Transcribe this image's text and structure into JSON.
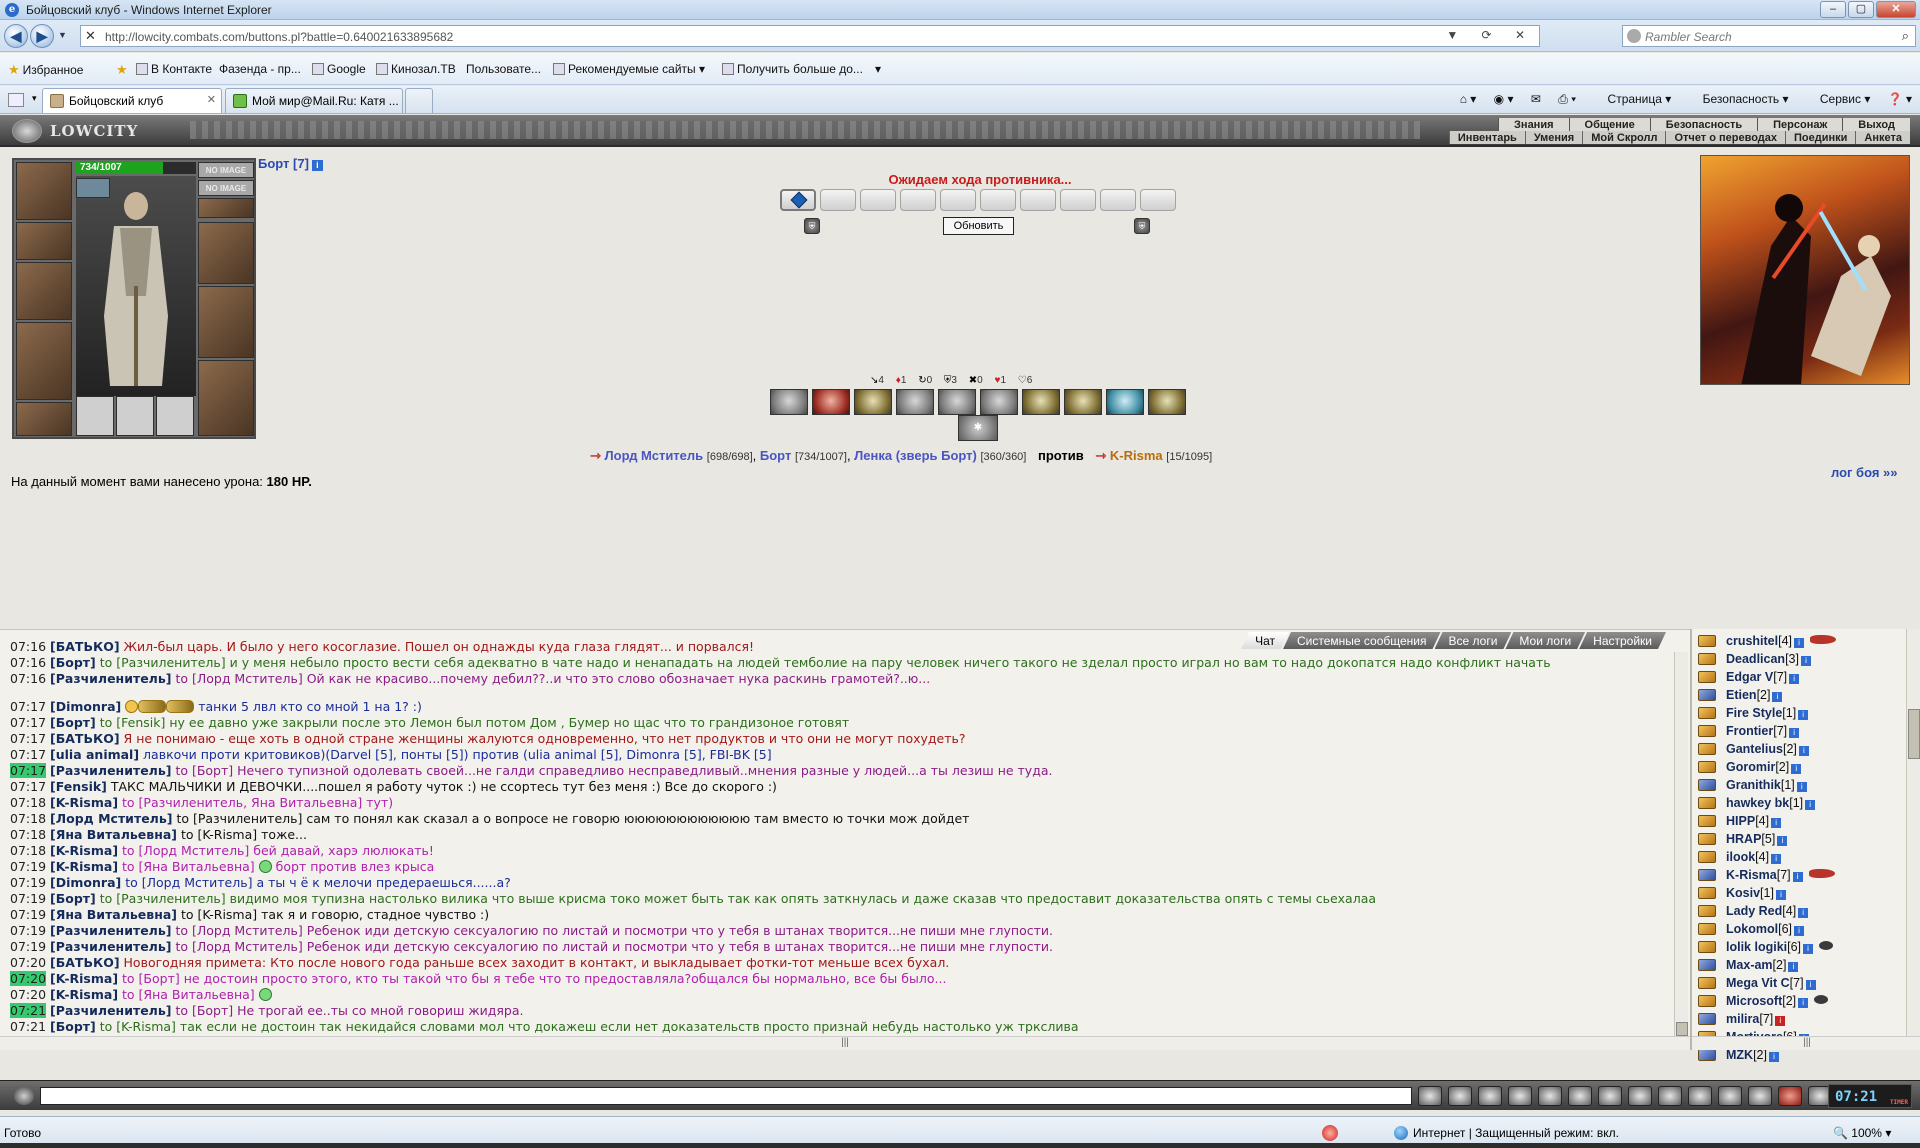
{
  "window": {
    "title": "Бойцовский клуб - Windows Internet Explorer"
  },
  "browser": {
    "url": "http://lowcity.combats.com/buttons.pl?battle=0.640021633895682",
    "search_placeholder": "Rambler Search",
    "favorites_label": "Избранное",
    "favorites": [
      "В Контакте",
      "Фазенда - пр...",
      "Google",
      "Кинозал.ТВ",
      "Пользовате...",
      "Рекомендуемые сайты",
      "Получить больше до..."
    ],
    "tabs": [
      {
        "label": "Бойцовский клуб",
        "active": true
      },
      {
        "label": "Мой мир@Mail.Ru: Катя ...",
        "active": false
      }
    ],
    "tools": {
      "page": "Страница",
      "safety": "Безопасность",
      "service": "Сервис"
    },
    "status_ready": "Готово",
    "status_zone": "Интернет | Защищенный режим: вкл.",
    "zoom": "100%"
  },
  "game": {
    "logo": "LOWCITY",
    "menu_top": [
      "Знания",
      "Общение",
      "Безопасность",
      "Персонаж",
      "Выход"
    ],
    "menu_bottom": [
      "Инвентарь",
      "Умения",
      "Мой Скролл",
      "Отчет о переводах",
      "Поединки",
      "Анкета"
    ],
    "character": {
      "name": "Борт [7]",
      "hp_text": "734/1007",
      "hp_fraction": 0.729,
      "noimage": [
        "NO IMAGE",
        "NO IMAGE"
      ]
    },
    "battle": {
      "waiting": "Ожидаем хода противника...",
      "refresh_label": "Обновить",
      "counters": [
        "4",
        "1",
        "0",
        "3",
        "0",
        "1",
        "6"
      ],
      "team1": [
        {
          "name": "Лорд Мститель",
          "hp": "[698/698]"
        },
        {
          "name": "Борт",
          "hp": "[734/1007]"
        },
        {
          "name": "Ленка (зверь Борт)",
          "hp": "[360/360]"
        }
      ],
      "vs": "против",
      "team2": [
        {
          "name": "K-Risma",
          "hp": "[15/1095]"
        }
      ],
      "damage_label": "На данный момент вами нанесено урона:",
      "damage_value": "180 HP.",
      "log_link": "лог боя »»"
    }
  },
  "chat": {
    "tabs": [
      "Чат",
      "Системные сообщения",
      "Все логи",
      "Мои логи",
      "Настройки"
    ],
    "messages": [
      {
        "time": "07:16",
        "name": "[БАТЬКО]",
        "to": "",
        "text": "Жил-был царь. И было у него косоглазие. Пошел он однажды куда глаза глядят... и порвался!",
        "color": "red"
      },
      {
        "time": "07:16",
        "name": "[Борт]",
        "to": "to [Разчиленитель]",
        "text": "и у меня небыло просто вести себя адекватно в чате надо и ненападать на людей темболие на пару человек ничего такого не зделал просто играл но вам то надо докопатся надо конфликт начать",
        "color": "green"
      },
      {
        "time": "07:16",
        "name": "[Разчиленитель]",
        "to": "to [Лорд Мститель]",
        "text": "Ой как не красиво...почему дебил??..и что это слово обозначает нука раскинь грамотей?..ю...",
        "color": "purple"
      },
      {
        "time": "07:17",
        "name": "[Dimonra]",
        "to": "",
        "text": "танки 5 лвл кто со мной 1 на 1? :)",
        "color": "blue"
      },
      {
        "time": "07:17",
        "name": "[Борт]",
        "to": "to [Fensik]",
        "text": "ну ее давно уже закрыли после это Лемон был потом Дом , Бумер но щас что то грандизоное готовят",
        "color": "green"
      },
      {
        "time": "07:17",
        "name": "[БАТЬКО]",
        "to": "",
        "text": "Я не понимаю - еще хоть в одной стране женщины жалуются одновременно, что нет продуктов и что они не могут похудеть?",
        "color": "red"
      },
      {
        "time": "07:17",
        "name": "[ulia animal]",
        "to": "",
        "text": "лавкочи проти критовиков)(Darvel [5], понты [5]) против (ulia animal [5], Dimonra [5], FBI-BK [5]",
        "color": "blue"
      },
      {
        "time": "07:17",
        "name": "[Разчиленитель]",
        "to": "to [Борт]",
        "text": "Нечего тупизной одолевать своей...не галди справедливо несправедливый..мнения разные у людей...а ты лезиш не туда.",
        "color": "purple"
      },
      {
        "time": "07:17",
        "name": "[Fensik]",
        "to": "",
        "text": "ТАКС МАЛЬЧИКИ И ДЕВОЧКИ....пошел я работу чуток :) не ссортесь тут без меня :) Все до скорого :)",
        "color": "black"
      },
      {
        "time": "07:18",
        "name": "[K-Risma]",
        "to": "",
        "text": "to [Разчиленитель, Яна Витальевна] тут)",
        "color": "mag"
      },
      {
        "time": "07:18",
        "name": "[Лорд Мститель]",
        "to": "to [Разчиленитель]",
        "text": "сам то понял как сказал а о вопросе не говорю юююююююююююю там вместо ю точки мож дойдет",
        "color": "black"
      },
      {
        "time": "07:18",
        "name": "[Яна Витальевна]",
        "to": "to [K-Risma]",
        "text": "тоже...",
        "color": "black"
      },
      {
        "time": "07:18",
        "name": "[K-Risma]",
        "to": "to [Лорд Мститель]",
        "text": "бей давай, харэ люлюкать!",
        "color": "mag"
      },
      {
        "time": "07:19",
        "name": "[K-Risma]",
        "to": "to [Яна Витальевна]",
        "text": "борт против влез крыса",
        "color": "mag"
      },
      {
        "time": "07:19",
        "name": "[Dimonra]",
        "to": "to [Лорд Мститель]",
        "text": "а ты ч ё к мелочи предераешься......а?",
        "color": "blue"
      },
      {
        "time": "07:19",
        "name": "[Борт]",
        "to": "to [Разчиленитель]",
        "text": "видимо моя тупизна настолько вилика что выше крисма токо может быть так как опять заткнулась и даже сказав что предоставит доказательства опять с темы сьехалаа",
        "color": "green"
      },
      {
        "time": "07:19",
        "name": "[Яна Витальевна]",
        "to": "to [K-Risma]",
        "text": "так я и говорю, стадное чувство :)",
        "color": "black"
      },
      {
        "time": "07:19",
        "name": "[Разчиленитель]",
        "to": "to [Лорд Мститель]",
        "text": "Ребенок иди детскую сексуалогию по листай и посмотри что у тебя в штанах творится...не пиши мне глупости.",
        "color": "purple"
      },
      {
        "time": "07:19",
        "name": "[Разчиленитель]",
        "to": "to [Лорд Мститель]",
        "text": "Ребенок иди детскую сексуалогию по листай и посмотри что у тебя в штанах творится...не пиши мне глупости.",
        "color": "purple"
      },
      {
        "time": "07:20",
        "name": "[БАТЬКО]",
        "to": "",
        "text": "Новогодняя примета: Кто после нового года раньше всех заходит в контакт, и выкладывает фотки-тот меньше всех бухал.",
        "color": "red"
      },
      {
        "time": "07:20",
        "name": "[K-Risma]",
        "to": "to [Борт]",
        "text": "не достоин просто этого, кто ты такой что бы я тебе что то предоставляла?общался бы нормально, все бы было...",
        "color": "mag"
      },
      {
        "time": "07:20",
        "name": "[K-Risma]",
        "to": "to [Яна Витальевна]",
        "text": "",
        "color": "mag"
      },
      {
        "time": "07:21",
        "name": "[Разчиленитель]",
        "to": "to [Борт]",
        "text": "Не трогай ее..ты со мной говориш жидяра.",
        "color": "purple"
      },
      {
        "time": "07:21",
        "name": "[Борт]",
        "to": "to [K-Risma]",
        "text": "так если не достоин так некидайся словами мол что докажеш если нет доказательств просто признай небудь настолько уж трксливa",
        "color": "green"
      }
    ]
  },
  "online": [
    {
      "name": "crushitel",
      "lv": "[4]"
    },
    {
      "name": "Deadlican",
      "lv": "[3]"
    },
    {
      "name": "Edgar V",
      "lv": "[7]"
    },
    {
      "name": "Etien",
      "lv": "[2]"
    },
    {
      "name": "Fire Style",
      "lv": "[1]"
    },
    {
      "name": "Frontier",
      "lv": "[7]"
    },
    {
      "name": "Gantelius",
      "lv": "[2]"
    },
    {
      "name": "Goromir",
      "lv": "[2]"
    },
    {
      "name": "Granithik",
      "lv": "[1]"
    },
    {
      "name": "hawkey bk",
      "lv": "[1]"
    },
    {
      "name": "HIPP",
      "lv": "[4]"
    },
    {
      "name": "HRAP",
      "lv": "[5]"
    },
    {
      "name": "ilook",
      "lv": "[4]"
    },
    {
      "name": "K-Risma",
      "lv": "[7]"
    },
    {
      "name": "Kosiv",
      "lv": "[1]"
    },
    {
      "name": "Lady Red",
      "lv": "[4]"
    },
    {
      "name": "Lokomol",
      "lv": "[6]"
    },
    {
      "name": "lolik logiki",
      "lv": "[6]"
    },
    {
      "name": "Max-am",
      "lv": "[2]"
    },
    {
      "name": "Mega Vit C",
      "lv": "[7]"
    },
    {
      "name": "Microsoft",
      "lv": "[2]"
    },
    {
      "name": "milira",
      "lv": "[7]"
    },
    {
      "name": "Mortivore",
      "lv": "[6]"
    },
    {
      "name": "MZK",
      "lv": "[2]"
    }
  ],
  "clock": "07:21"
}
